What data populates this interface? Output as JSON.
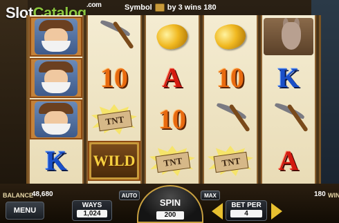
{
  "header": {
    "logo_slot": "Slot",
    "logo_catalog": "Catalog",
    "logo_com": ".com",
    "win_prefix": "Symbol",
    "win_symbol_icon": "miner-icon",
    "win_suffix": "by 3 wins 180"
  },
  "reels": [
    {
      "symbols": [
        "miner",
        "miner",
        "miner",
        "K"
      ],
      "highlighted": [
        true,
        true,
        true,
        false
      ]
    },
    {
      "symbols": [
        "pickaxe",
        "10",
        "TNT",
        "WILD"
      ],
      "highlighted": [
        false,
        false,
        false,
        true
      ]
    },
    {
      "symbols": [
        "gold-nugget",
        "A",
        "10",
        "TNT"
      ],
      "highlighted": [
        false,
        false,
        false,
        false
      ]
    },
    {
      "symbols": [
        "gold-nugget",
        "10",
        "pickaxe",
        "TNT"
      ],
      "highlighted": [
        false,
        false,
        false,
        false
      ]
    },
    {
      "symbols": [
        "donkey",
        "K",
        "pickaxe",
        "A"
      ],
      "highlighted": [
        false,
        false,
        false,
        false
      ]
    }
  ],
  "symbol_text": {
    "k": "K",
    "a": "A",
    "ten": "10",
    "tnt": "TNT",
    "wild": "WILD"
  },
  "footer": {
    "balance_label": "BALANCE",
    "balance_value": "48,680",
    "win_value": "180",
    "win_label": "WIN",
    "menu_label": "MENU",
    "ways_label": "WAYS",
    "ways_value": "1,024",
    "auto_label": "AUTO",
    "max_label": "MAX",
    "spin_label": "SPIN",
    "spin_value": "200",
    "bet_per_label": "BET PER",
    "bet_per_value": "4"
  },
  "colors": {
    "accent_gold": "#e8c030",
    "brand_green": "#8cc63f",
    "highlight": "#c4823a"
  }
}
